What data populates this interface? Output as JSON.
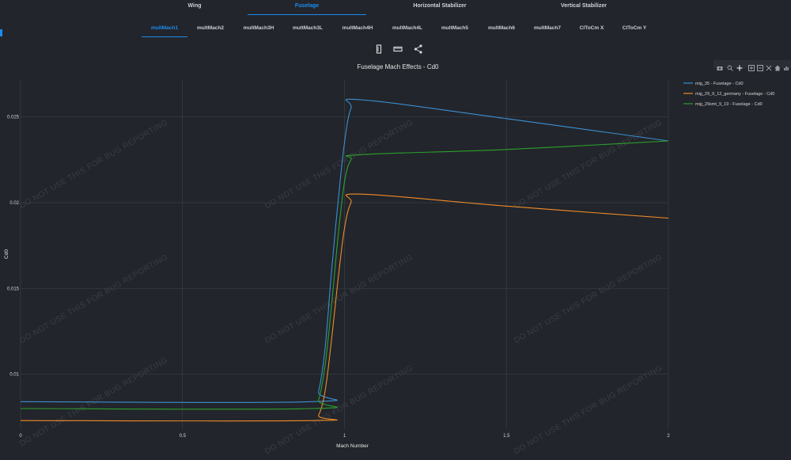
{
  "tabs": [
    {
      "label": "Wing",
      "active": false
    },
    {
      "label": "Fuselage",
      "active": true
    },
    {
      "label": "Horizontal Stabilizer",
      "active": false
    },
    {
      "label": "Vertical Stabilizer",
      "active": false
    }
  ],
  "subtabs": [
    {
      "label": "multMach1",
      "active": true
    },
    {
      "label": "multMach2",
      "active": false
    },
    {
      "label": "multMach3H",
      "active": false
    },
    {
      "label": "multMach3L",
      "active": false
    },
    {
      "label": "multMach4H",
      "active": false
    },
    {
      "label": "multMach4L",
      "active": false
    },
    {
      "label": "multMach5",
      "active": false
    },
    {
      "label": "multMach6",
      "active": false
    },
    {
      "label": "multMach7",
      "active": false
    },
    {
      "label": "ClToCm X",
      "active": false
    },
    {
      "label": "ClToCm Y",
      "active": false
    }
  ],
  "toolbar": [
    "ruler-icon",
    "tape-icon",
    "share-icon"
  ],
  "modebar": [
    "camera-icon",
    "zoom-icon",
    "pan-icon",
    "zoom-in-icon",
    "zoom-out-icon",
    "autoscale-icon",
    "reset-icon",
    "home-icon",
    "plotly-logo-icon"
  ],
  "watermark": "DO NOT USE THIS FOR BUG REPORTING",
  "chart_data": {
    "type": "line",
    "title": "Fuselage Mach Effects - Cd0",
    "xlabel": "Mach Number",
    "ylabel": "Cd0",
    "xlim": [
      0,
      2
    ],
    "ylim": [
      0.0068,
      0.0272
    ],
    "xticks": [
      0,
      0.5,
      1,
      1.5,
      2
    ],
    "xtick_labels": [
      "0",
      "0.5",
      "1",
      "1.5",
      "2"
    ],
    "yticks": [
      0.01,
      0.015,
      0.02,
      0.025
    ],
    "ytick_labels": [
      "0.01",
      "0.015",
      "0.02",
      "0.025"
    ],
    "grid": true,
    "legend_position": "right",
    "series": [
      {
        "name": "mig_35 - Fuselage - Cd0",
        "color": "#3b8fd1",
        "x": [
          0,
          0.9,
          0.92,
          0.94,
          0.96,
          0.98,
          1.0,
          1.02,
          1.05,
          1.5,
          2.0
        ],
        "y": [
          0.0084,
          0.0084,
          0.009,
          0.0115,
          0.016,
          0.02,
          0.0235,
          0.0255,
          0.026,
          0.0249,
          0.0236
        ]
      },
      {
        "name": "mig_29_9_12_germany - Fuselage - Cd0",
        "color": "#f08c28",
        "x": [
          0,
          0.9,
          0.92,
          0.94,
          0.96,
          0.98,
          1.0,
          1.02,
          1.05,
          1.5,
          2.0
        ],
        "y": [
          0.0073,
          0.0073,
          0.0076,
          0.009,
          0.012,
          0.0155,
          0.0185,
          0.02,
          0.0205,
          0.0198,
          0.0191
        ]
      },
      {
        "name": "mig_29smt_9_19 - Fuselage - Cd0",
        "color": "#2ca02c",
        "x": [
          0,
          0.9,
          0.92,
          0.94,
          0.96,
          0.98,
          1.0,
          1.02,
          1.05,
          1.5,
          2.0
        ],
        "y": [
          0.008,
          0.008,
          0.0085,
          0.0105,
          0.014,
          0.018,
          0.0212,
          0.0225,
          0.0228,
          0.0231,
          0.0236
        ]
      }
    ]
  }
}
